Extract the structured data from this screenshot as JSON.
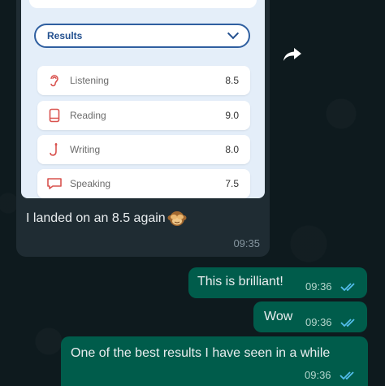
{
  "incoming": {
    "screenshot": {
      "select_label": "Results",
      "rows": [
        {
          "icon": "ear-icon",
          "label": "Listening",
          "score": "8.5"
        },
        {
          "icon": "book-icon",
          "label": "Reading",
          "score": "9.0"
        },
        {
          "icon": "pen-icon",
          "label": "Writing",
          "score": "8.0"
        },
        {
          "icon": "speech-bubble-icon",
          "label": "Speaking",
          "score": "7.5"
        }
      ]
    },
    "caption": "I landed on an 8.5 again",
    "time": "09:35"
  },
  "outgoing": [
    {
      "text": "This is brilliant!",
      "time": "09:36"
    },
    {
      "text": "Wow",
      "time": "09:36"
    },
    {
      "text": "One of the best results I have seen in a while",
      "time": "09:36"
    }
  ],
  "colors": {
    "incoming_bubble": "#1f2c33",
    "outgoing_bubble": "#005c4b",
    "read_ticks": "#53bdeb",
    "icon_red": "#d9534f"
  }
}
